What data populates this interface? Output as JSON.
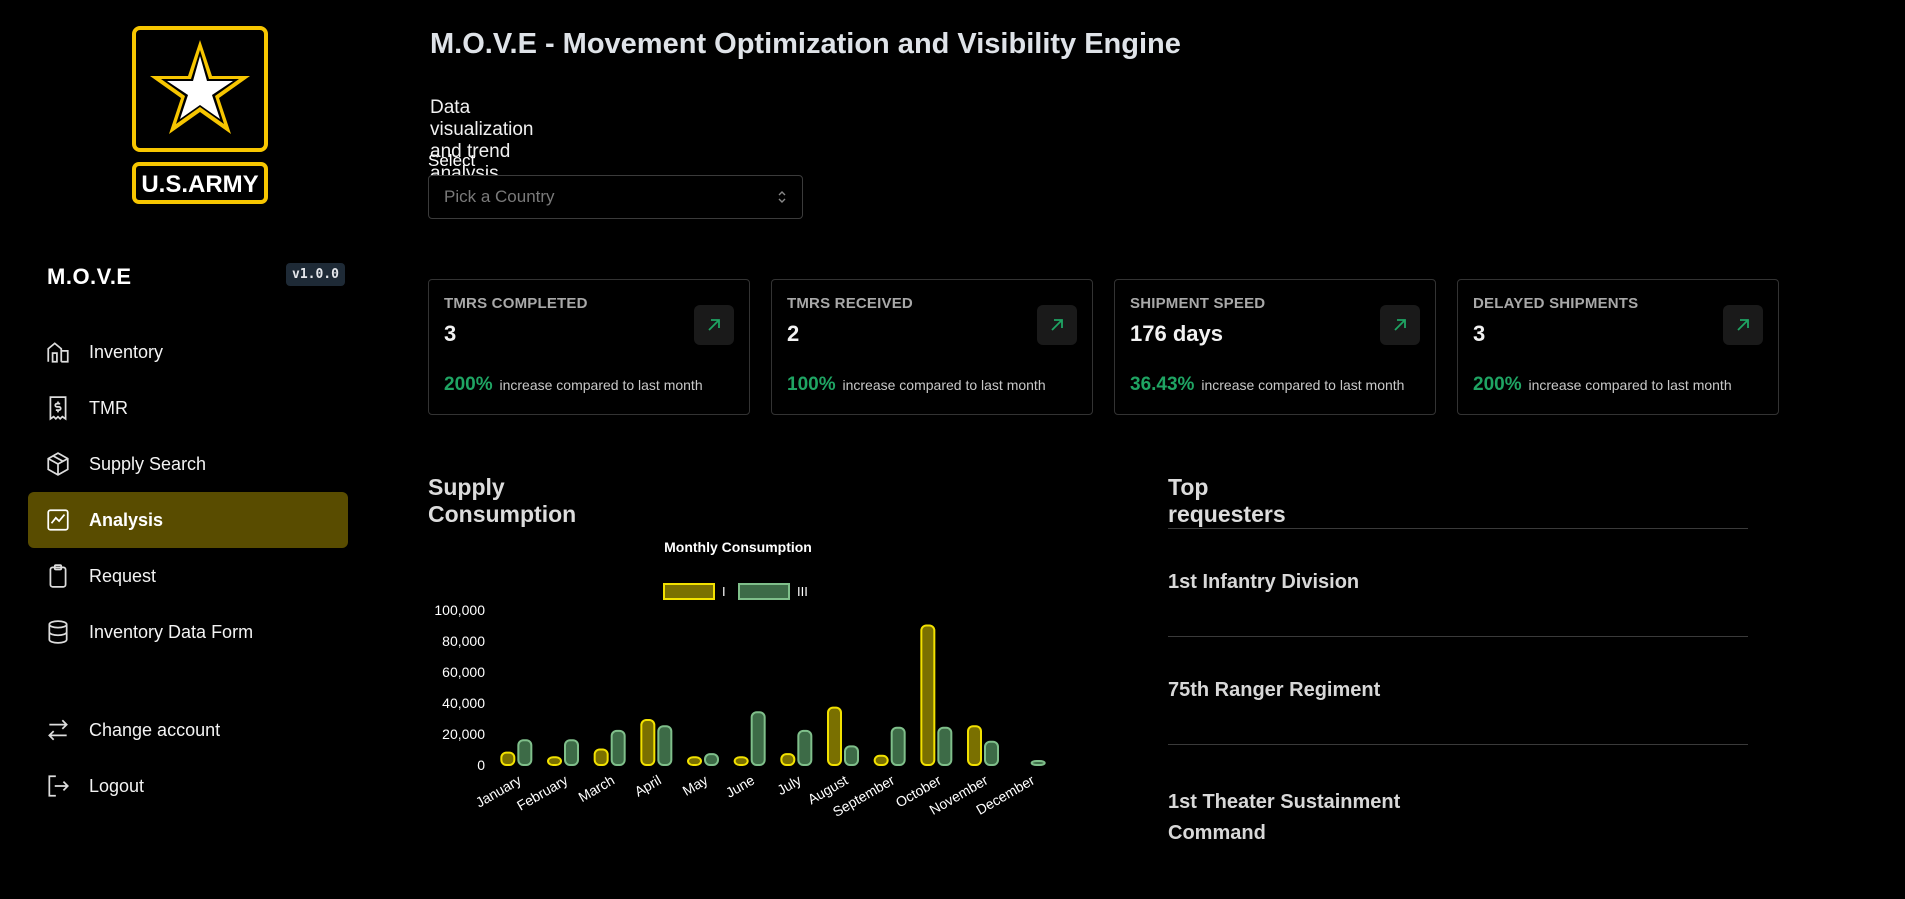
{
  "sidebar": {
    "logo_text": "U.S.ARMY",
    "brand": "M.O.V.E",
    "version": "v1.0.0",
    "items": [
      {
        "label": "Inventory",
        "icon": "building-icon"
      },
      {
        "label": "TMR",
        "icon": "receipt-dollar-icon"
      },
      {
        "label": "Supply Search",
        "icon": "box-icon"
      },
      {
        "label": "Analysis",
        "icon": "chart-line-icon",
        "active": true
      },
      {
        "label": "Request",
        "icon": "clipboard-icon"
      },
      {
        "label": "Inventory Data Form",
        "icon": "database-icon"
      }
    ],
    "account_items": [
      {
        "label": "Change account",
        "icon": "swap-arrows-icon"
      },
      {
        "label": "Logout",
        "icon": "logout-icon"
      }
    ]
  },
  "header": {
    "title": "M.O.V.E - Movement Optimization and Visibility Engine",
    "subtitle": "Data visualization and trend analysis page."
  },
  "country_select": {
    "label": "Select Country",
    "placeholder": "Pick a Country"
  },
  "stats": [
    {
      "title": "TMRS COMPLETED",
      "value": "3",
      "pct": "200%",
      "note": "increase compared to last month"
    },
    {
      "title": "TMRS RECEIVED",
      "value": "2",
      "pct": "100%",
      "note": "increase compared to last month"
    },
    {
      "title": "SHIPMENT SPEED",
      "value": "176 days",
      "pct": "36.43%",
      "note": "increase compared to last month"
    },
    {
      "title": "DELAYED SHIPMENTS",
      "value": "3",
      "pct": "200%",
      "note": "increase compared to last month"
    }
  ],
  "supply": {
    "title": "Supply Consumption"
  },
  "requesters": {
    "title": "Top requesters",
    "items": [
      "1st Infantry Division",
      "75th Ranger Regiment",
      "1st Theater Sustainment Command"
    ]
  },
  "colors": {
    "accent": "#594c00",
    "green": "#1fa463",
    "series_I": "#f2e100",
    "series_III": "#7fbf8a"
  },
  "chart_data": {
    "type": "bar",
    "title": "Monthly Consumption",
    "categories": [
      "January",
      "February",
      "March",
      "April",
      "May",
      "June",
      "July",
      "August",
      "September",
      "October",
      "November",
      "December"
    ],
    "series": [
      {
        "name": "I",
        "values": [
          8000,
          5000,
          10000,
          29000,
          5000,
          5000,
          7000,
          37000,
          6000,
          90000,
          25000,
          0
        ]
      },
      {
        "name": "III",
        "values": [
          16000,
          16000,
          22000,
          25000,
          7000,
          34000,
          22000,
          12000,
          24000,
          24000,
          15000,
          2000
        ]
      }
    ],
    "yticks": [
      0,
      20000,
      40000,
      60000,
      80000,
      100000
    ],
    "ytick_labels": [
      "0",
      "20,000",
      "40,000",
      "60,000",
      "80,000",
      "100,000"
    ],
    "ylim": [
      0,
      100000
    ],
    "legend_position": "top-center"
  }
}
